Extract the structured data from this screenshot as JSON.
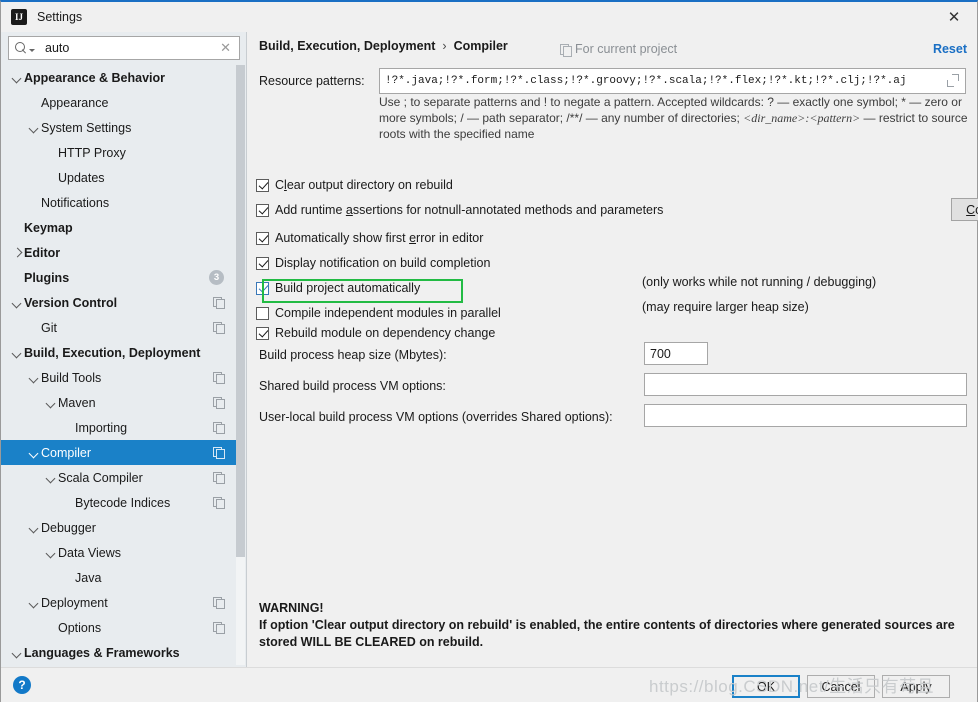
{
  "window": {
    "title": "Settings",
    "app_icon": "intellij-idea-icon",
    "close_icon": "close-icon"
  },
  "sidebar": {
    "search": {
      "value": "auto",
      "placeholder": "",
      "search_icon": "search-icon",
      "clear_icon": "clear-icon"
    },
    "items": [
      {
        "label": "Appearance & Behavior",
        "indent": 0,
        "arrow": "down",
        "bold": true
      },
      {
        "label": "Appearance",
        "indent": 1,
        "arrow": "none",
        "bold": false
      },
      {
        "label": "System Settings",
        "indent": 1,
        "arrow": "down",
        "bold": false
      },
      {
        "label": "HTTP Proxy",
        "indent": 2,
        "arrow": "none",
        "bold": false
      },
      {
        "label": "Updates",
        "indent": 2,
        "arrow": "none",
        "bold": false
      },
      {
        "label": "Notifications",
        "indent": 1,
        "arrow": "none",
        "bold": false
      },
      {
        "label": "Keymap",
        "indent": 0,
        "arrow": "none",
        "bold": true
      },
      {
        "label": "Editor",
        "indent": 0,
        "arrow": "right",
        "bold": true
      },
      {
        "label": "Plugins",
        "indent": 0,
        "arrow": "none",
        "bold": true,
        "badge": "3"
      },
      {
        "label": "Version Control",
        "indent": 0,
        "arrow": "down",
        "bold": true,
        "copy": true
      },
      {
        "label": "Git",
        "indent": 1,
        "arrow": "none",
        "bold": false,
        "copy": true
      },
      {
        "label": "Build, Execution, Deployment",
        "indent": 0,
        "arrow": "down",
        "bold": true
      },
      {
        "label": "Build Tools",
        "indent": 1,
        "arrow": "down",
        "bold": false,
        "copy": true
      },
      {
        "label": "Maven",
        "indent": 2,
        "arrow": "down",
        "bold": false,
        "copy": true
      },
      {
        "label": "Importing",
        "indent": 3,
        "arrow": "none",
        "bold": false,
        "copy": true
      },
      {
        "label": "Compiler",
        "indent": 1,
        "arrow": "down",
        "bold": false,
        "copy": true,
        "selected": true
      },
      {
        "label": "Scala Compiler",
        "indent": 2,
        "arrow": "down",
        "bold": false,
        "copy": true
      },
      {
        "label": "Bytecode Indices",
        "indent": 3,
        "arrow": "none",
        "bold": false,
        "copy": true
      },
      {
        "label": "Debugger",
        "indent": 1,
        "arrow": "down",
        "bold": false
      },
      {
        "label": "Data Views",
        "indent": 2,
        "arrow": "down",
        "bold": false
      },
      {
        "label": "Java",
        "indent": 3,
        "arrow": "none",
        "bold": false
      },
      {
        "label": "Deployment",
        "indent": 1,
        "arrow": "down",
        "bold": false,
        "copy": true
      },
      {
        "label": "Options",
        "indent": 2,
        "arrow": "none",
        "bold": false,
        "copy": true
      },
      {
        "label": "Languages & Frameworks",
        "indent": 0,
        "arrow": "down",
        "bold": true
      }
    ]
  },
  "main": {
    "breadcrumb_root": "Build, Execution, Deployment",
    "breadcrumb_sep": "›",
    "breadcrumb_leaf": "Compiler",
    "for_current_project": "For current project",
    "project_icon": "copy-scope-icon",
    "reset_label": "Reset",
    "resource_patterns_label": "Resource patterns:",
    "resource_patterns_value": "!?*.java;!?*.form;!?*.class;!?*.groovy;!?*.scala;!?*.flex;!?*.kt;!?*.clj;!?*.aj",
    "resource_expand_icon": "expand-icon",
    "resource_help": "Use ; to separate patterns and ! to negate a pattern. Accepted wildcards: ? — exactly one symbol; * — zero or more symbols; / — path separator; /**/ — any number of directories; <dir_name>:<pattern> — restrict to source roots with the specified name",
    "checkboxes": [
      {
        "label": "Clear output directory on rebuild",
        "checked": true,
        "mnemonic": "l"
      },
      {
        "label": "Add runtime assertions for notnull-annotated methods and parameters",
        "checked": true,
        "mnemonic": "a"
      },
      {
        "label": "Automatically show first error in editor",
        "checked": true,
        "mnemonic": "e"
      },
      {
        "label": "Display notification on build completion",
        "checked": true,
        "mnemonic": ""
      },
      {
        "label": "Build project automatically",
        "checked": true,
        "highlighted": true,
        "mnemonic": ""
      },
      {
        "label": "Compile independent modules in parallel",
        "checked": false,
        "mnemonic": ""
      },
      {
        "label": "Rebuild module on dependency change",
        "checked": true,
        "mnemonic": ""
      }
    ],
    "configure_annotations_label": "Configure annotations...",
    "hint_build_auto": "(only works while not running / debugging)",
    "hint_parallel": "(may require larger heap size)",
    "heap_label": "Build process heap size (Mbytes):",
    "heap_value": "700",
    "shared_vm_label": "Shared build process VM options:",
    "shared_vm_value": "",
    "userlocal_vm_label": "User-local build process VM options (overrides Shared options):",
    "userlocal_vm_value": "",
    "warning_title": "WARNING!",
    "warning_body": "If option 'Clear output directory on rebuild' is enabled, the entire contents of directories where generated sources are stored WILL BE CLEARED on rebuild."
  },
  "footer": {
    "help_icon": "help-icon",
    "help_label": "?",
    "ok_label": "OK",
    "cancel_label": "Cancel",
    "apply_label": "Apply",
    "watermark": "https://blog.CSDN.net/生活只有苟且"
  },
  "colors": {
    "accent": "#1a81c8",
    "link": "#1a6fc4",
    "highlight": "#22bb44",
    "sidebar_bg": "#e8ecef",
    "panel_bg": "#f0f0f0"
  }
}
